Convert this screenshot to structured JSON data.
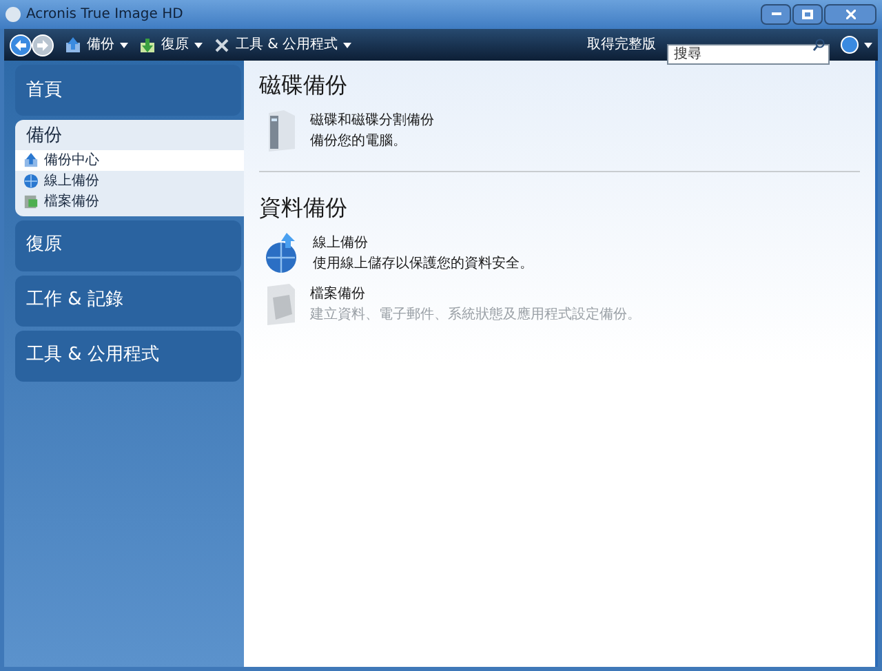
{
  "window": {
    "title": "Acronis True Image HD"
  },
  "toolbar": {
    "menus": [
      {
        "label": "備份",
        "kind": "backup"
      },
      {
        "label": "復原",
        "kind": "restore"
      },
      {
        "label": "工具 & 公用程式",
        "kind": "tools"
      }
    ],
    "upgrade_link": "取得完整版",
    "search": {
      "placeholder": "搜尋"
    }
  },
  "sidebar": {
    "items": [
      {
        "label": "首頁",
        "expanded": false,
        "selected": false
      },
      {
        "label": "備份",
        "expanded": true,
        "selected": true,
        "children": [
          {
            "label": "備份中心",
            "kind": "center",
            "selected": true
          },
          {
            "label": "線上備份",
            "kind": "online",
            "selected": false
          },
          {
            "label": "檔案備份",
            "kind": "file",
            "selected": false
          }
        ]
      },
      {
        "label": "復原",
        "expanded": false,
        "selected": false
      },
      {
        "label": "工作 & 記錄",
        "expanded": false,
        "selected": false
      },
      {
        "label": "工具 & 公用程式",
        "expanded": false,
        "selected": false
      }
    ]
  },
  "sections": [
    {
      "title": "磁碟備份",
      "items": [
        {
          "kind": "disk",
          "title": "磁碟和磁碟分割備份",
          "description": "備份您的電腦。",
          "disabled": false
        }
      ]
    },
    {
      "title": "資料備份",
      "items": [
        {
          "kind": "online",
          "title": "線上備份",
          "description": "使用線上儲存以保護您的資料安全。",
          "disabled": false
        },
        {
          "kind": "file",
          "title": "檔案備份",
          "description": "建立資料、電子郵件、系統狀態及應用程式設定備份。",
          "disabled": true
        }
      ]
    }
  ]
}
